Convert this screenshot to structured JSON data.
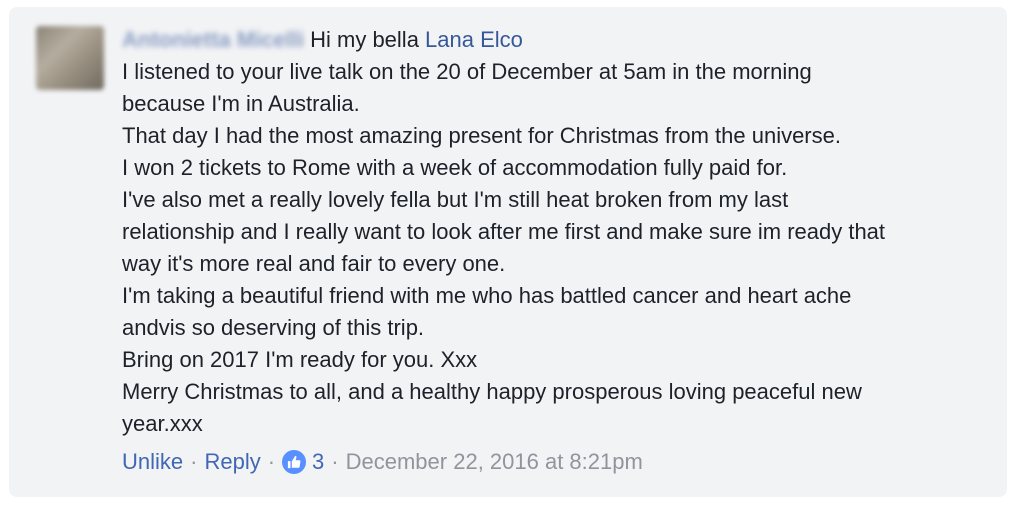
{
  "comment": {
    "author": "Antonietta Micelli",
    "greeting": "Hi my bella ",
    "mention": "Lana Elco",
    "paragraphs": [
      "I listened to your live talk on the 20 of December at 5am in the morning\nbecause I'm in Australia.",
      "That day I had the most amazing present for Christmas from the universe.",
      "I won 2 tickets to Rome with a week of accommodation fully paid for.",
      "I've also met a really lovely fella but I'm still heat broken from my last\nrelationship and I really want to look after me first and make sure im ready that\nway it's more real and fair to every one.",
      "I'm taking a beautiful friend with me who has battled cancer and heart ache\nandvis so deserving of this trip.",
      "Bring on 2017 I'm ready for you. Xxx",
      "Merry Christmas to all, and a healthy happy prosperous loving peaceful new\nyear.xxx"
    ]
  },
  "actions": {
    "unlike_label": "Unlike",
    "reply_label": "Reply",
    "separator": "·",
    "like_icon": "thumbs-up-icon",
    "like_count": "3",
    "timestamp": "December 22, 2016 at 8:21pm"
  },
  "colors": {
    "background": "#f2f3f5",
    "link": "#4267b2",
    "mention": "#365899",
    "text": "#1d2129",
    "meta": "#90949c",
    "like_badge": "#5890ff"
  }
}
